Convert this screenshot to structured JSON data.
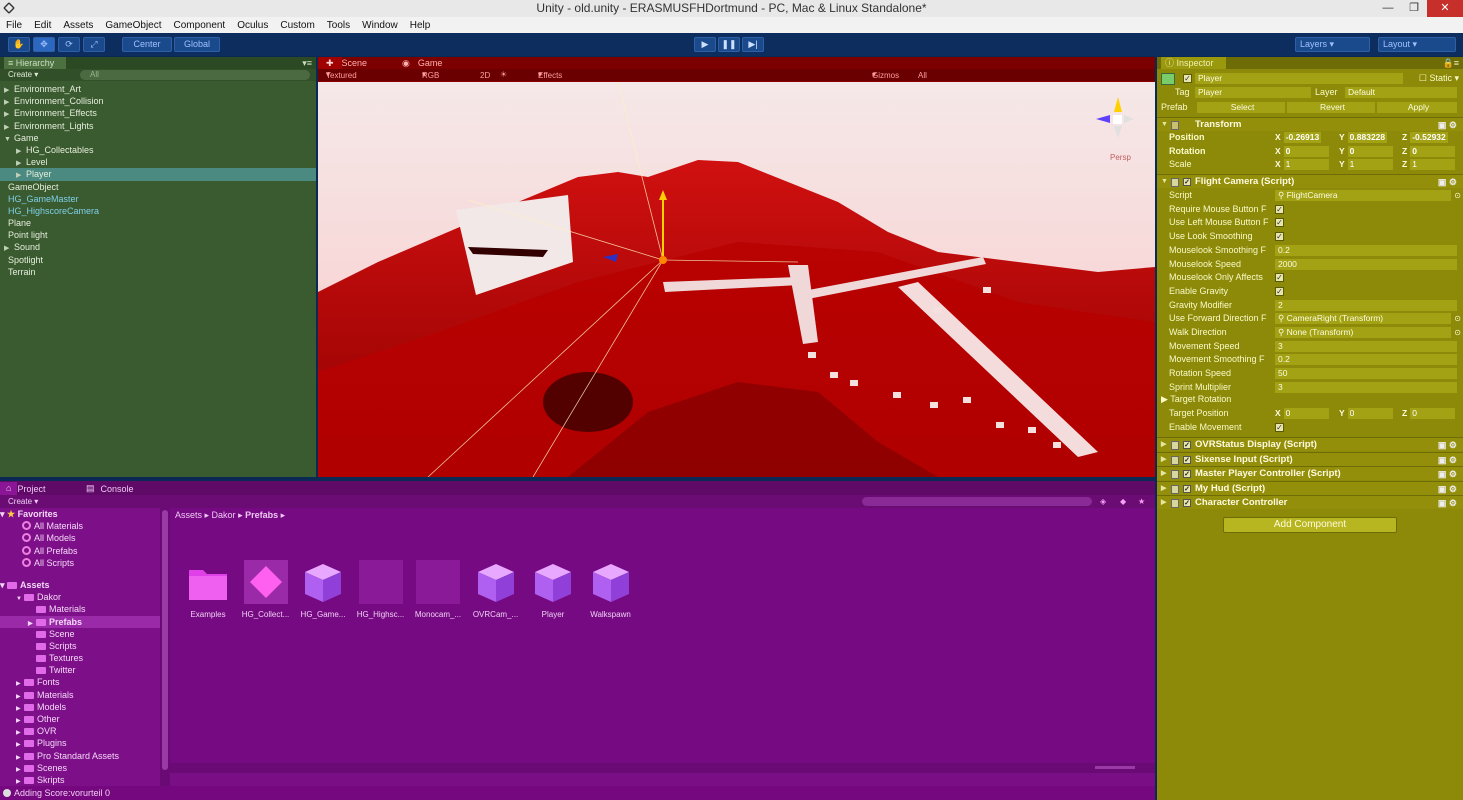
{
  "window": {
    "title": "Unity - old.unity - ERASMUSFHDortmund - PC, Mac & Linux Standalone*"
  },
  "menu": [
    "File",
    "Edit",
    "Assets",
    "GameObject",
    "Component",
    "Oculus",
    "Custom",
    "Tools",
    "Window",
    "Help"
  ],
  "toolbar": {
    "pivot": "Center",
    "space": "Global",
    "layers": "Layers",
    "layout": "Layout"
  },
  "hierarchy": {
    "tab": "Hierarchy",
    "create": "Create",
    "search_placeholder": "All",
    "items": [
      {
        "label": "Environment_Art",
        "indent": 0,
        "arrow": true,
        "selected": false,
        "prefab": false
      },
      {
        "label": "Environment_Collision",
        "indent": 0,
        "arrow": true,
        "selected": false,
        "prefab": false
      },
      {
        "label": "Environment_Effects",
        "indent": 0,
        "arrow": true,
        "selected": false,
        "prefab": false
      },
      {
        "label": "Environment_Lights",
        "indent": 0,
        "arrow": true,
        "selected": false,
        "prefab": false
      },
      {
        "label": "Game",
        "indent": 0,
        "arrow": true,
        "selected": false,
        "prefab": false,
        "open": true
      },
      {
        "label": "HG_Collectables",
        "indent": 1,
        "arrow": true,
        "selected": false,
        "prefab": false
      },
      {
        "label": "Level",
        "indent": 1,
        "arrow": true,
        "selected": false,
        "prefab": false
      },
      {
        "label": "Player",
        "indent": 1,
        "arrow": true,
        "selected": true,
        "prefab": false
      },
      {
        "label": "GameObject",
        "indent": 0,
        "arrow": false,
        "selected": false,
        "prefab": false
      },
      {
        "label": "HG_GameMaster",
        "indent": 0,
        "arrow": false,
        "selected": false,
        "prefab": true
      },
      {
        "label": "HG_HighscoreCamera",
        "indent": 0,
        "arrow": false,
        "selected": false,
        "prefab": true
      },
      {
        "label": "Plane",
        "indent": 0,
        "arrow": false,
        "selected": false,
        "prefab": false
      },
      {
        "label": "Point light",
        "indent": 0,
        "arrow": false,
        "selected": false,
        "prefab": false
      },
      {
        "label": "Sound",
        "indent": 0,
        "arrow": true,
        "selected": false,
        "prefab": false
      },
      {
        "label": "Spotlight",
        "indent": 0,
        "arrow": false,
        "selected": false,
        "prefab": false
      },
      {
        "label": "Terrain",
        "indent": 0,
        "arrow": false,
        "selected": false,
        "prefab": false
      }
    ]
  },
  "scene": {
    "tab_scene": "Scene",
    "tab_game": "Game",
    "shading": "Textured",
    "rgb": "RGB",
    "mode2d": "2D",
    "effects": "Effects",
    "gizmos": "Gizmos",
    "gizmo_search": "All",
    "persp": "Persp"
  },
  "project": {
    "tab_project": "Project",
    "tab_console": "Console",
    "create": "Create",
    "breadcrumb": [
      "Assets",
      "Dakor",
      "Prefabs"
    ],
    "favorites_label": "Favorites",
    "favorites": [
      "All Materials",
      "All Models",
      "All Prefabs",
      "All Scripts"
    ],
    "assets_label": "Assets",
    "tree": [
      {
        "label": "Dakor",
        "indent": 1,
        "selected": false
      },
      {
        "label": "Materials",
        "indent": 2,
        "selected": false
      },
      {
        "label": "Prefabs",
        "indent": 2,
        "selected": true
      },
      {
        "label": "Scene",
        "indent": 2,
        "selected": false
      },
      {
        "label": "Scripts",
        "indent": 2,
        "selected": false
      },
      {
        "label": "Textures",
        "indent": 2,
        "selected": false
      },
      {
        "label": "Twitter",
        "indent": 2,
        "selected": false
      },
      {
        "label": "Fonts",
        "indent": 1,
        "selected": false
      },
      {
        "label": "Materials",
        "indent": 1,
        "selected": false
      },
      {
        "label": "Models",
        "indent": 1,
        "selected": false
      },
      {
        "label": "Other",
        "indent": 1,
        "selected": false
      },
      {
        "label": "OVR",
        "indent": 1,
        "selected": false
      },
      {
        "label": "Plugins",
        "indent": 1,
        "selected": false
      },
      {
        "label": "Pro Standard Assets",
        "indent": 1,
        "selected": false
      },
      {
        "label": "Scenes",
        "indent": 1,
        "selected": false
      },
      {
        "label": "Skripts",
        "indent": 1,
        "selected": false
      }
    ],
    "assets": [
      {
        "label": "Examples",
        "kind": "folder"
      },
      {
        "label": "HG_Collect...",
        "kind": "diamond"
      },
      {
        "label": "HG_Game...",
        "kind": "cube"
      },
      {
        "label": "HG_Highsc...",
        "kind": "blank"
      },
      {
        "label": "Monocam_...",
        "kind": "blank"
      },
      {
        "label": "OVRCam_...",
        "kind": "cube"
      },
      {
        "label": "Player",
        "kind": "cube"
      },
      {
        "label": "Walkspawn",
        "kind": "cube"
      }
    ]
  },
  "status": {
    "message": "Adding Score:vorurteil 0"
  },
  "inspector": {
    "tab": "Inspector",
    "object_name": "Player",
    "static_label": "Static",
    "tag_label": "Tag",
    "tag_value": "Player",
    "layer_label": "Layer",
    "layer_value": "Default",
    "prefab_label": "Prefab",
    "select": "Select",
    "revert": "Revert",
    "apply": "Apply",
    "transform": {
      "title": "Transform",
      "position": {
        "label": "Position",
        "x": "-0.26913",
        "y": "0.883228",
        "z": "-0.52932"
      },
      "rotation": {
        "label": "Rotation",
        "x": "0",
        "y": "0",
        "z": "0"
      },
      "scale": {
        "label": "Scale",
        "x": "1",
        "y": "1",
        "z": "1"
      }
    },
    "flight_camera": {
      "title": "Flight Camera (Script)",
      "fields": [
        {
          "label": "Script",
          "value": "FlightCamera",
          "type": "obj"
        },
        {
          "label": "Require Mouse Button F",
          "value": "✓",
          "type": "check"
        },
        {
          "label": "Use Left Mouse Button F",
          "value": "✓",
          "type": "check"
        },
        {
          "label": "Use Look Smoothing",
          "value": "✓",
          "type": "check"
        },
        {
          "label": "Mouselook Smoothing F",
          "value": "0.2",
          "type": "text"
        },
        {
          "label": "Mouselook Speed",
          "value": "2000",
          "type": "text"
        },
        {
          "label": "Mouselook Only Affects",
          "value": "✓",
          "type": "check"
        },
        {
          "label": "Enable Gravity",
          "value": "✓",
          "type": "check"
        },
        {
          "label": "Gravity Modifier",
          "value": "2",
          "type": "text"
        },
        {
          "label": "Use Forward Direction F",
          "value": "CameraRight (Transform)",
          "type": "obj"
        },
        {
          "label": "Walk Direction",
          "value": "None (Transform)",
          "type": "obj"
        },
        {
          "label": "Movement Speed",
          "value": "3",
          "type": "text"
        },
        {
          "label": "Movement Smoothing F",
          "value": "0.2",
          "type": "text"
        },
        {
          "label": "Rotation Speed",
          "value": "50",
          "type": "text"
        },
        {
          "label": "Sprint Multiplier",
          "value": "3",
          "type": "text"
        }
      ],
      "target_rotation": "Target Rotation",
      "target_position": {
        "label": "Target Position",
        "x": "0",
        "y": "0",
        "z": "0"
      },
      "enable_movement": {
        "label": "Enable Movement",
        "value": "✓"
      }
    },
    "components": [
      "OVRStatus Display (Script)",
      "Sixense Input (Script)",
      "Master Player Controller (Script)",
      "My Hud (Script)",
      "Character Controller"
    ],
    "add_component": "Add Component"
  }
}
